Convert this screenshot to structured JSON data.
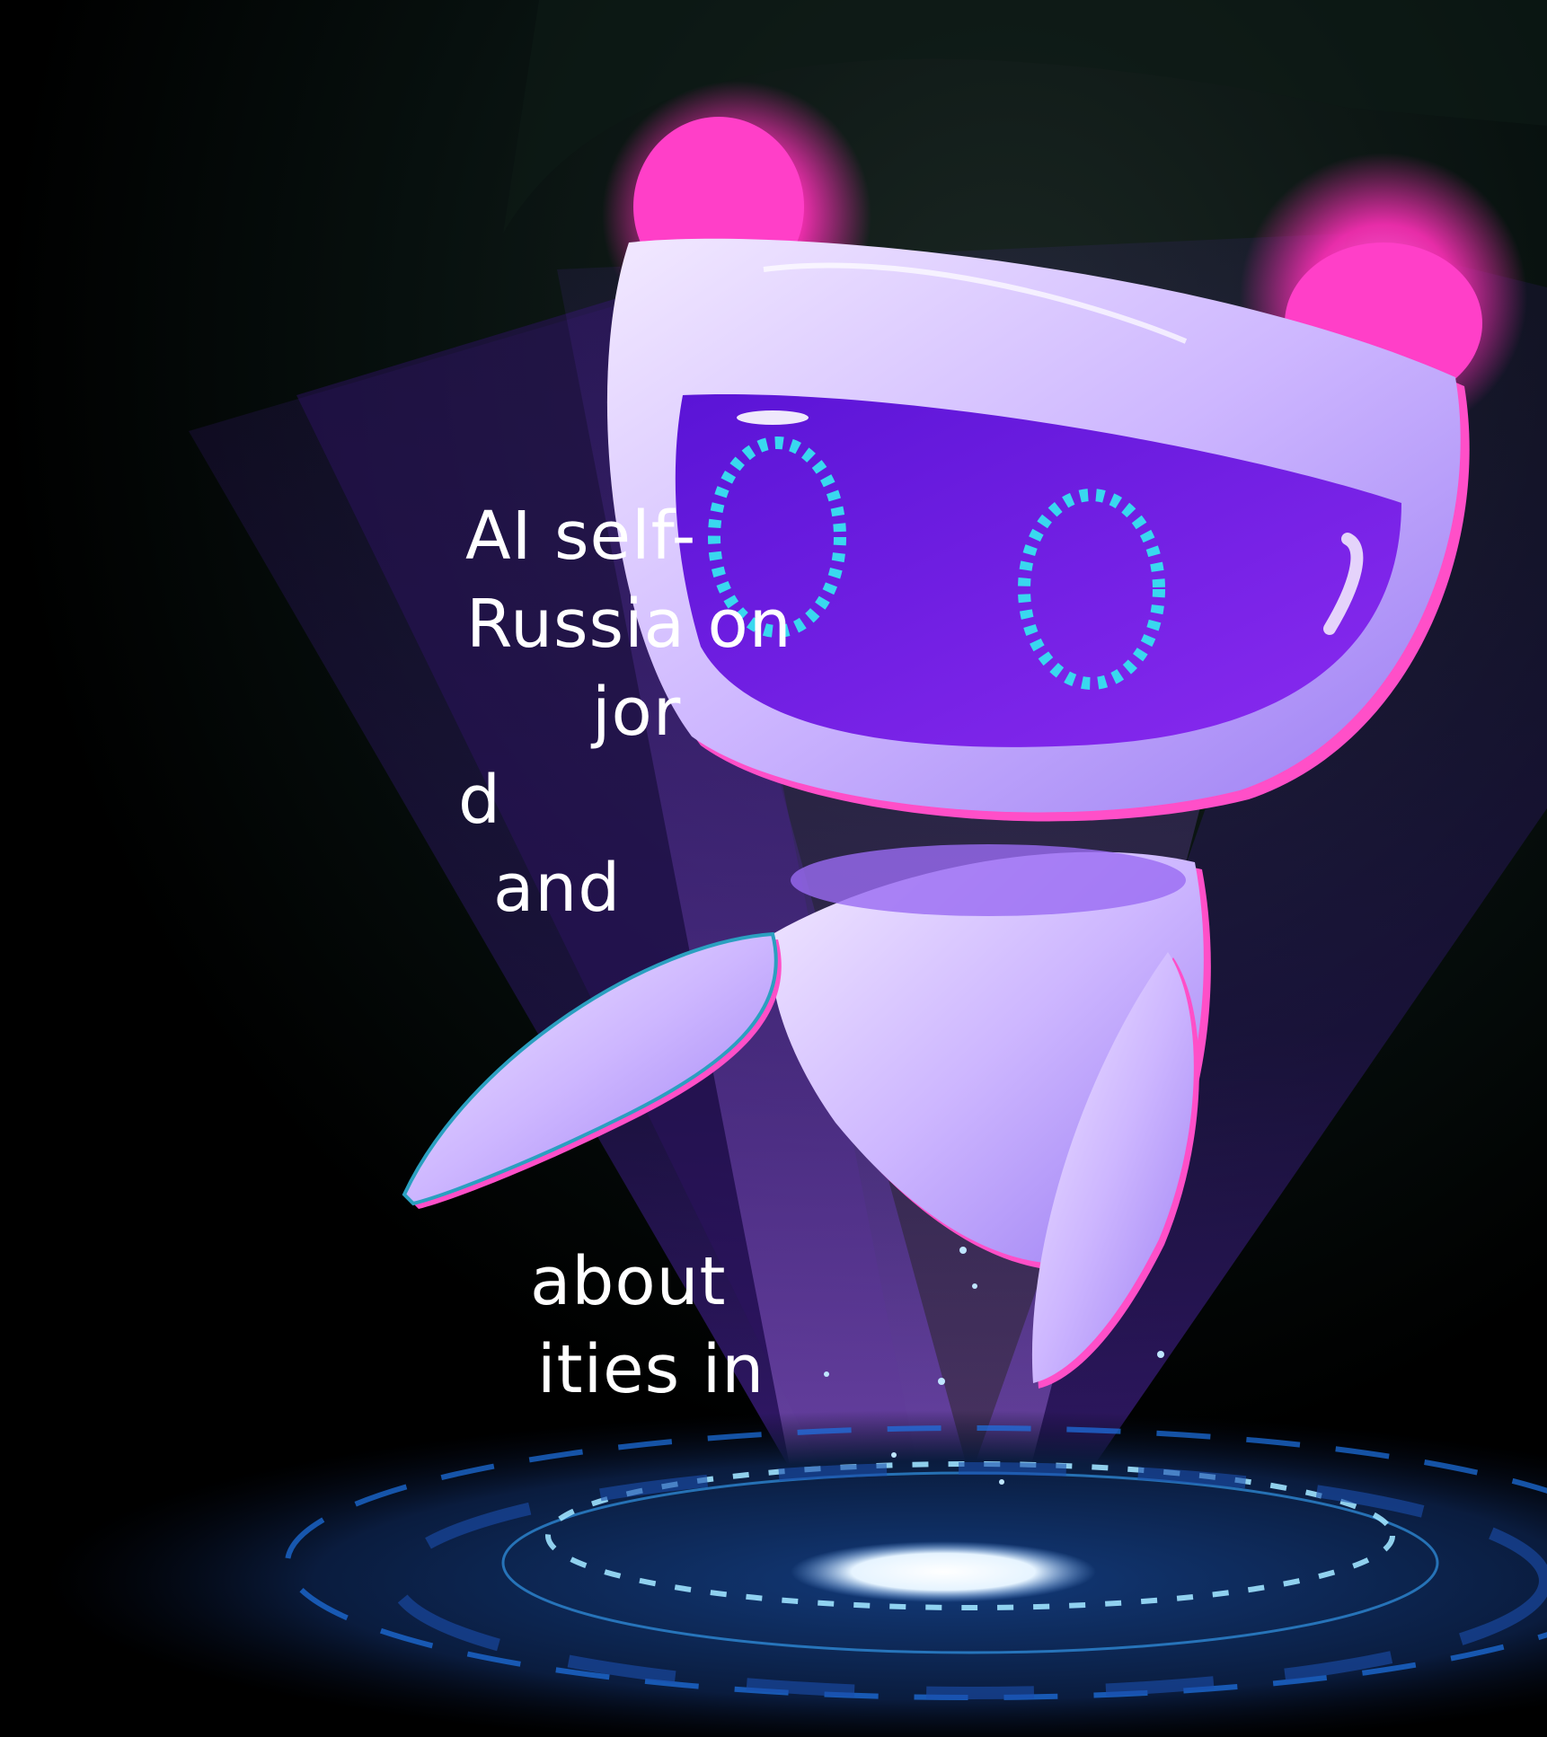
{
  "text": {
    "paragraph_1": [
      "AI self-",
      "Russia on",
      "jor",
      "d",
      "and"
    ],
    "paragraph_2": [
      "about",
      "ities in"
    ]
  },
  "illustration": {
    "subject": "robot-hologram",
    "colors": {
      "background": "#000000",
      "glow_pink": "#ff2fb8",
      "body_light": "#d9c8ff",
      "visor_purple": "#7b1fe6",
      "eye_cyan": "#39d8ef",
      "beam_purple": "#5b23b8",
      "platform_blue": "#1e74e6"
    }
  }
}
